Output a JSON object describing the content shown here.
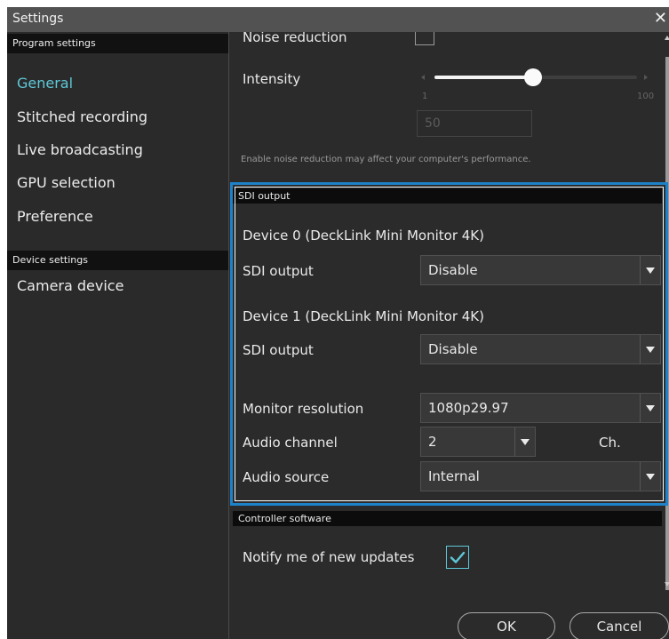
{
  "window": {
    "title": "Settings",
    "close_glyph": "✕"
  },
  "sidebar": {
    "program_header": "Program settings",
    "program_items": [
      {
        "label": "General",
        "active": true
      },
      {
        "label": "Stitched recording",
        "active": false
      },
      {
        "label": "Live broadcasting",
        "active": false
      },
      {
        "label": "GPU selection",
        "active": false
      },
      {
        "label": "Preference",
        "active": false
      }
    ],
    "device_header": "Device settings",
    "device_items": [
      {
        "label": "Camera device"
      }
    ]
  },
  "noise": {
    "label": "Noise reduction",
    "intensity_label": "Intensity",
    "slider_min": "1",
    "slider_max": "100",
    "slider_value": 50,
    "value_box": "50",
    "note": "Enable noise reduction may affect your computer's performance."
  },
  "sdi": {
    "header": "SDI output",
    "device0_title": "Device 0 (DeckLink Mini Monitor 4K)",
    "device0_output_label": "SDI output",
    "device0_output_value": "Disable",
    "device1_title": "Device 1 (DeckLink Mini Monitor 4K)",
    "device1_output_label": "SDI output",
    "device1_output_value": "Disable",
    "monitor_res_label": "Monitor resolution",
    "monitor_res_value": "1080p29.97",
    "audio_channel_label": "Audio channel",
    "audio_channel_value": "2",
    "audio_channel_unit": "Ch.",
    "audio_source_label": "Audio source",
    "audio_source_value": "Internal"
  },
  "controller": {
    "header": "Controller software",
    "notify_label": "Notify me of new updates",
    "notify_checked": true
  },
  "buttons": {
    "ok": "OK",
    "cancel": "Cancel"
  },
  "colors": {
    "accent": "#5ec8d8",
    "highlight_border": "#1e82c8",
    "background": "#2b2b2b"
  }
}
